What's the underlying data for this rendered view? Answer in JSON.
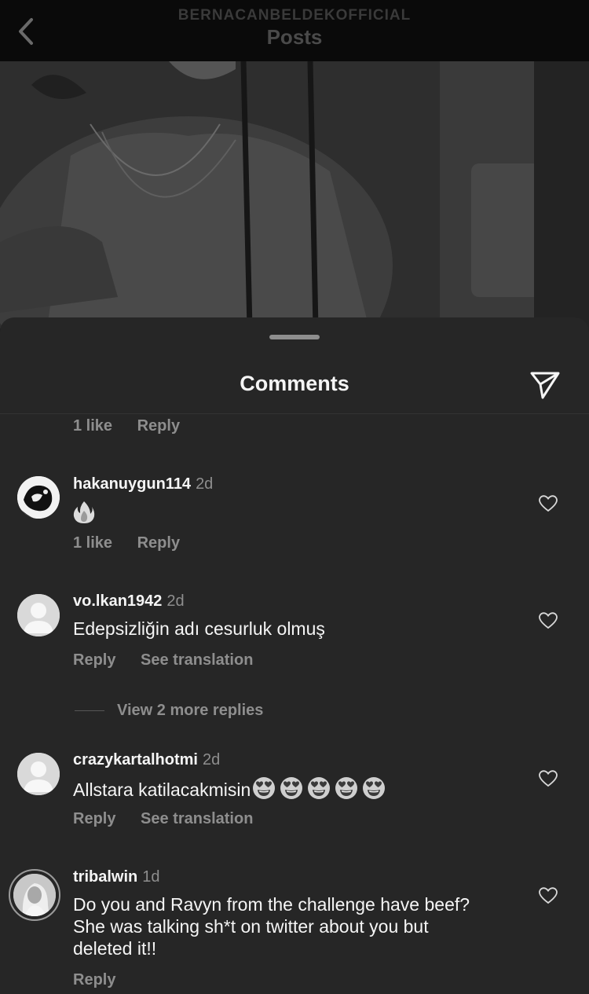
{
  "header": {
    "account": "BERNACANBELDEKOFFICIAL",
    "title": "Posts"
  },
  "sheet": {
    "title": "Comments"
  },
  "top_partial": {
    "likes": "1 like",
    "reply": "Reply"
  },
  "comments": [
    {
      "username": "hakanuygun114",
      "time": "2d",
      "text": "🔥",
      "likes": "1 like",
      "reply": "Reply"
    },
    {
      "username": "vo.lkan1942",
      "time": "2d",
      "text": "Edepsizliğin adı cesurluk olmuş",
      "reply": "Reply",
      "translate": "See translation",
      "view_replies": "View 2 more replies"
    },
    {
      "username": "crazykartalhotmi",
      "time": "2d",
      "text": "Allstara katilacakmisin",
      "emoji_count": 5,
      "reply": "Reply",
      "translate": "See translation"
    },
    {
      "username": "tribalwin",
      "time": "1d",
      "text_lines": [
        "Do you and Ravyn from the challenge have beef?",
        "She was talking sh*t on twitter about you but",
        "deleted it!!"
      ],
      "reply": "Reply"
    }
  ],
  "icons": {
    "back": "chevron-left-icon",
    "share": "paper-plane-icon",
    "heart": "heart-outline-icon",
    "fire": "fire-emoji",
    "heart_eyes": "heart-eyes-emoji"
  }
}
